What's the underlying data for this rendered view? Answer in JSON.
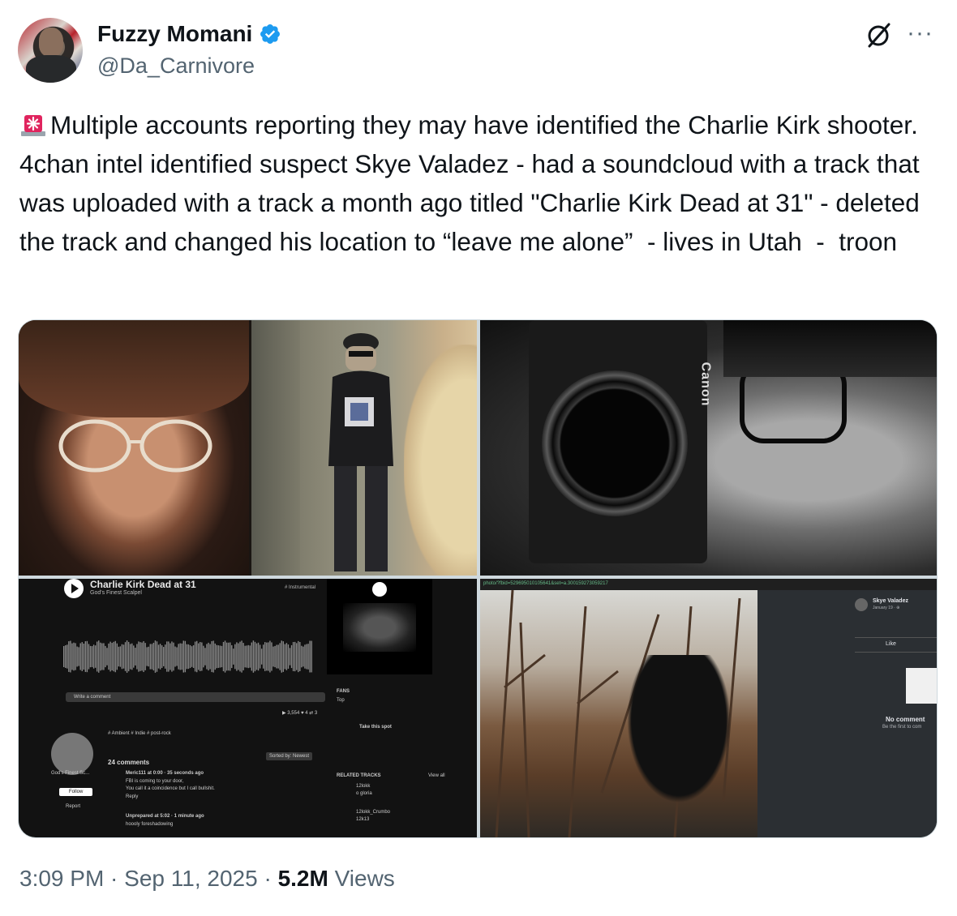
{
  "author": {
    "display_name": "Fuzzy Momani",
    "handle": "@Da_Carnivore",
    "verified": true,
    "verified_color": "#1d9bf0"
  },
  "header_icons": {
    "grok": "grok-icon",
    "more": "more-options-icon",
    "more_glyph": "···"
  },
  "tweet": {
    "emoji": "rotating-light-icon",
    "text": "Multiple accounts reporting they may have identified the Charlie Kirk shooter.  4chan intel identified suspect Skye Valadez - had a soundcloud with a track that was uploaded with a track a month ago titled \"Charlie Kirk Dead at 31\" - deleted the track and changed his location to “leave me alone”  - lives in Utah  -  troon"
  },
  "media": {
    "image3": {
      "track_title": "Charlie Kirk Dead at 31",
      "artist": "God's Finest Scalpel",
      "tag": "# Instrumental",
      "write_comment": "Write a comment",
      "tags": "# Ambient   # Indie   # post-rock",
      "comments_count": "24 comments",
      "sorted": "Sorted by: Newest",
      "fans": "FANS",
      "top": "Top",
      "take_spot": "Take this spot",
      "related": "RELATED TRACKS",
      "view_all": "View all",
      "comment1_user": "Meric111 at 0:00 · 35 seconds ago",
      "comment1_text": "FBI is coming to your door,",
      "comment1_text2": "You call it a coincidence but I call bullshit.",
      "reply": "Reply",
      "comment2_user": "Unprepared at 5:02 · 1 minute ago",
      "comment2_text": "hoooly foreshadowing",
      "profile_name": "God's Finest Sc...",
      "follow": "Follow",
      "report": "Report",
      "stats": "▶ 3,554   ♥ 4   ⇄ 3",
      "related1": "12lokk",
      "related1b": "o gloria",
      "related2": "12lokk_Crumbo",
      "related2b": "12k13"
    },
    "image4": {
      "url": "photo/?fbid=529695010105641&set=a.300159273059217",
      "name": "Skye Valadez",
      "date": "January 19 · ⊕",
      "like": "Like",
      "no_comments": "No comment",
      "be_first": "Be the first to com"
    },
    "image2": {
      "camera_brand": "Canon"
    }
  },
  "meta": {
    "time": "3:09 PM",
    "separator": " · ",
    "date": "Sep 11, 2025",
    "views_count": "5.2M",
    "views_label": "Views"
  }
}
